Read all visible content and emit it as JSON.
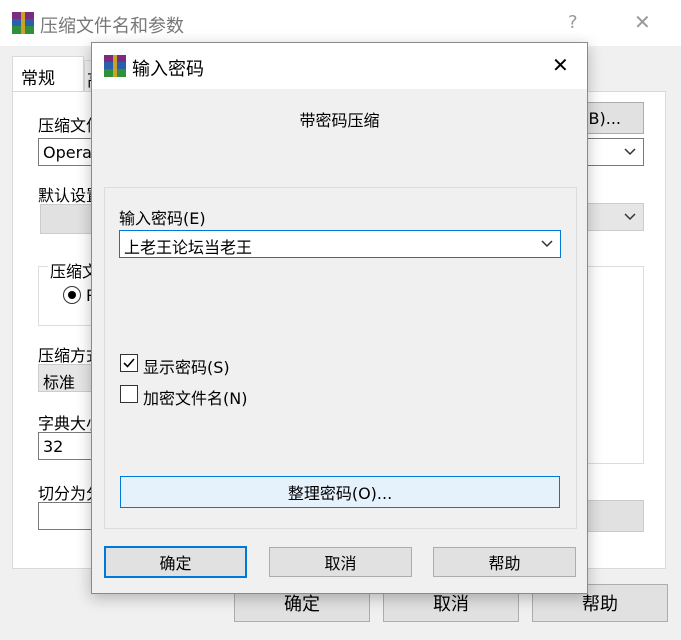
{
  "back_window": {
    "title": "压缩文件名和参数",
    "help_glyph": "?",
    "close_glyph": "✕",
    "tabs": [
      "常规",
      "高"
    ],
    "archive_name_label": "压缩文件",
    "browse_button": "(B)...",
    "archive_name_value": "Operat",
    "default_profile_label": "默认设置",
    "archive_format_label": "压缩文",
    "archive_format_radio": "R",
    "method_label": "压缩方式",
    "method_value": "标准",
    "dict_label": "字典大小",
    "dict_value": "32",
    "split_label": "切分为分",
    "ok": "确定",
    "cancel": "取消",
    "help": "帮助"
  },
  "dialog": {
    "title": "输入密码",
    "close_glyph": "✕",
    "subtitle": "带密码压缩",
    "password_label": "输入密码(E)",
    "password_value": "上老王论坛当老王",
    "show_password": "显示密码(S)",
    "show_password_checked": true,
    "encrypt_names": "加密文件名(N)",
    "encrypt_names_checked": false,
    "organize_button": "整理密码(O)...",
    "ok": "确定",
    "cancel": "取消",
    "help": "帮助"
  },
  "colors": {
    "accent_focus": "#0078d7",
    "button_bg": "#e1e1e1",
    "panel_bg": "#f0f0f0",
    "hover_button_bg": "#e5f1fb"
  }
}
